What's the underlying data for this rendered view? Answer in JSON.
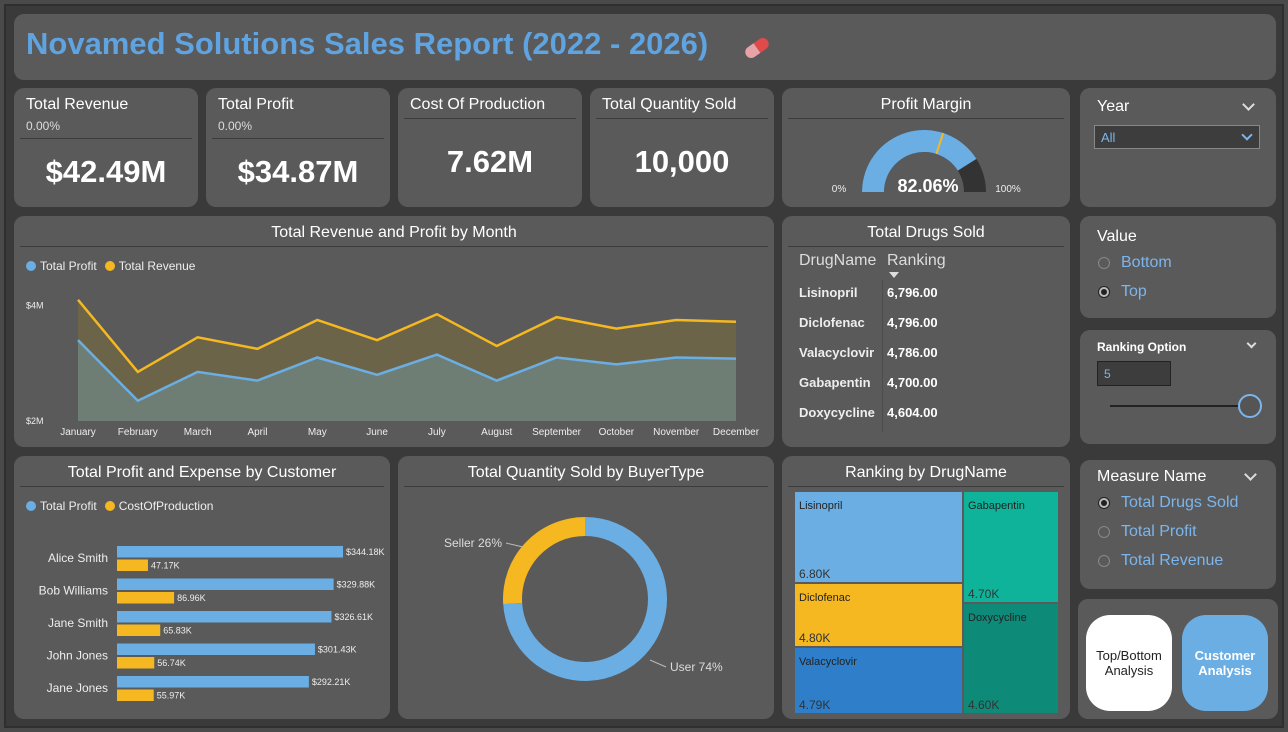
{
  "header": {
    "title": "Novamed Solutions Sales Report (2022 - 2026)",
    "icon": "pill-icon"
  },
  "kpis": {
    "total_revenue": {
      "label": "Total Revenue",
      "change": "0.00%",
      "value": "$42.49M"
    },
    "total_profit": {
      "label": "Total Profit",
      "change": "0.00%",
      "value": "$34.87M"
    },
    "cost_of_production": {
      "label": "Cost Of Production",
      "value": "7.62M"
    },
    "total_quantity_sold": {
      "label": "Total Quantity Sold",
      "value": "10,000"
    }
  },
  "profit_margin": {
    "title": "Profit Margin",
    "value_label": "82.06%",
    "min_label": "0%",
    "max_label": "100%",
    "value": 82.06,
    "target": 0.6
  },
  "year_slicer": {
    "label": "Year",
    "selected": "All"
  },
  "value_slicer": {
    "label": "Value",
    "options": [
      "Bottom",
      "Top"
    ],
    "selected": "Top"
  },
  "ranking_option": {
    "label": "Ranking Option",
    "value": "5",
    "slider_fraction": 1.0
  },
  "measure_slicer": {
    "label": "Measure Name",
    "options": [
      "Total Drugs Sold",
      "Total Profit",
      "Total Revenue"
    ],
    "selected": "Total Drugs Sold"
  },
  "nav_buttons": {
    "top_bottom": "Top/Bottom Analysis",
    "customer": "Customer Analysis"
  },
  "drugs_table": {
    "title": "Total Drugs Sold",
    "columns": [
      "DrugName",
      "Ranking"
    ],
    "rows": [
      {
        "name": "Lisinopril",
        "value": "6,796.00"
      },
      {
        "name": "Diclofenac",
        "value": "4,796.00"
      },
      {
        "name": "Valacyclovir",
        "value": "4,786.00"
      },
      {
        "name": "Gabapentin",
        "value": "4,700.00"
      },
      {
        "name": "Doxycycline",
        "value": "4,604.00"
      }
    ]
  },
  "colors": {
    "profit": "#6aaee4",
    "revenue": "#f5b821",
    "teal": "#0fb39a",
    "dark_teal": "#0e8a78",
    "blue": "#2f7ec9",
    "title": "#5fa3e0"
  },
  "chart_data": [
    {
      "type": "area",
      "title": "Total Revenue and Profit by Month",
      "categories": [
        "January",
        "February",
        "March",
        "April",
        "May",
        "June",
        "July",
        "August",
        "September",
        "October",
        "November",
        "December"
      ],
      "y_tick_labels": [
        "$2M",
        "$4M"
      ],
      "ylim": [
        2,
        4.2
      ],
      "series": [
        {
          "name": "Total Profit",
          "values": [
            3.4,
            2.35,
            2.85,
            2.7,
            3.1,
            2.8,
            3.15,
            2.7,
            3.1,
            2.98,
            3.1,
            3.08
          ]
        },
        {
          "name": "Total Revenue",
          "values": [
            4.1,
            2.85,
            3.45,
            3.25,
            3.75,
            3.4,
            3.85,
            3.3,
            3.8,
            3.6,
            3.75,
            3.72
          ]
        }
      ],
      "legend": "top-left"
    },
    {
      "type": "bar",
      "orientation": "horizontal",
      "title": "Total Profit and Expense by Customer",
      "categories": [
        "Alice Smith",
        "Bob Williams",
        "Jane Smith",
        "John Jones",
        "Jane Jones"
      ],
      "series": [
        {
          "name": "Total Profit",
          "values": [
            344.18,
            329.88,
            326.61,
            301.43,
            292.21
          ],
          "labels": [
            "$344.18K",
            "$329.88K",
            "$326.61K",
            "$301.43K",
            "$292.21K"
          ]
        },
        {
          "name": "CostOfProduction",
          "values": [
            47.17,
            86.96,
            65.83,
            56.74,
            55.97
          ],
          "labels": [
            "47.17K",
            "86.96K",
            "65.83K",
            "56.74K",
            "55.97K"
          ]
        }
      ],
      "legend": "top-left"
    },
    {
      "type": "pie",
      "donut": true,
      "title": "Total Quantity Sold by BuyerType",
      "slices": [
        {
          "name": "Seller",
          "value": 26,
          "label": "Seller 26%"
        },
        {
          "name": "User",
          "value": 74,
          "label": "User 74%"
        }
      ]
    },
    {
      "type": "treemap",
      "title": "Ranking by DrugName",
      "items": [
        {
          "name": "Lisinopril",
          "value": 6.8,
          "label": "6.80K"
        },
        {
          "name": "Gabapentin",
          "value": 4.7,
          "label": "4.70K"
        },
        {
          "name": "Diclofenac",
          "value": 4.8,
          "label": "4.80K"
        },
        {
          "name": "Doxycycline",
          "value": 4.6,
          "label": "4.60K"
        },
        {
          "name": "Valacyclovir",
          "value": 4.79,
          "label": "4.79K"
        }
      ]
    }
  ]
}
